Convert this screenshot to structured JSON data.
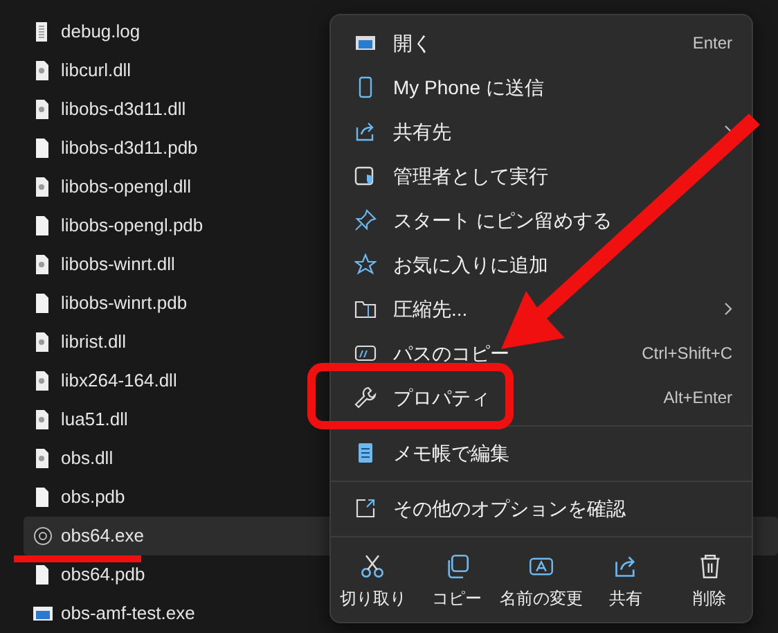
{
  "files": [
    {
      "name": "debug.log",
      "kind": "text",
      "selected": false
    },
    {
      "name": "libcurl.dll",
      "kind": "dll",
      "selected": false
    },
    {
      "name": "libobs-d3d11.dll",
      "kind": "dll",
      "selected": false
    },
    {
      "name": "libobs-d3d11.pdb",
      "kind": "blank",
      "selected": false
    },
    {
      "name": "libobs-opengl.dll",
      "kind": "dll",
      "selected": false
    },
    {
      "name": "libobs-opengl.pdb",
      "kind": "blank",
      "selected": false
    },
    {
      "name": "libobs-winrt.dll",
      "kind": "dll",
      "selected": false
    },
    {
      "name": "libobs-winrt.pdb",
      "kind": "blank",
      "selected": false
    },
    {
      "name": "librist.dll",
      "kind": "dll",
      "selected": false
    },
    {
      "name": "libx264-164.dll",
      "kind": "dll",
      "selected": false
    },
    {
      "name": "lua51.dll",
      "kind": "dll",
      "selected": false
    },
    {
      "name": "obs.dll",
      "kind": "dll",
      "selected": false
    },
    {
      "name": "obs.pdb",
      "kind": "blank",
      "selected": false
    },
    {
      "name": "obs64.exe",
      "kind": "app",
      "selected": true
    },
    {
      "name": "obs64.pdb",
      "kind": "blank",
      "selected": false
    },
    {
      "name": "obs-amf-test.exe",
      "kind": "window",
      "selected": false
    }
  ],
  "context_menu": {
    "groups": [
      [
        {
          "label": "開く",
          "shortcut": "Enter",
          "kind": "open",
          "submenu": false
        },
        {
          "label": "My Phone に送信",
          "kind": "phone",
          "submenu": false
        },
        {
          "label": "共有先",
          "kind": "share",
          "submenu": true
        },
        {
          "label": "管理者として実行",
          "kind": "admin",
          "submenu": false
        },
        {
          "label": "スタート にピン留めする",
          "kind": "pin",
          "submenu": false
        },
        {
          "label": "お気に入りに追加",
          "kind": "star",
          "submenu": false
        },
        {
          "label": "圧縮先...",
          "kind": "zip",
          "submenu": true
        },
        {
          "label": "パスのコピー",
          "shortcut": "Ctrl+Shift+C",
          "kind": "path",
          "submenu": false
        },
        {
          "label": "プロパティ",
          "shortcut": "Alt+Enter",
          "kind": "wrench",
          "submenu": false
        }
      ],
      [
        {
          "label": "メモ帳で編集",
          "kind": "notepad",
          "submenu": false
        }
      ],
      [
        {
          "label": "その他のオプションを確認",
          "kind": "more",
          "submenu": false
        }
      ]
    ],
    "actions": [
      {
        "label": "切り取り",
        "kind": "cut"
      },
      {
        "label": "コピー",
        "kind": "copy"
      },
      {
        "label": "名前の変更",
        "kind": "rename"
      },
      {
        "label": "共有",
        "kind": "share"
      },
      {
        "label": "削除",
        "kind": "delete"
      }
    ]
  }
}
